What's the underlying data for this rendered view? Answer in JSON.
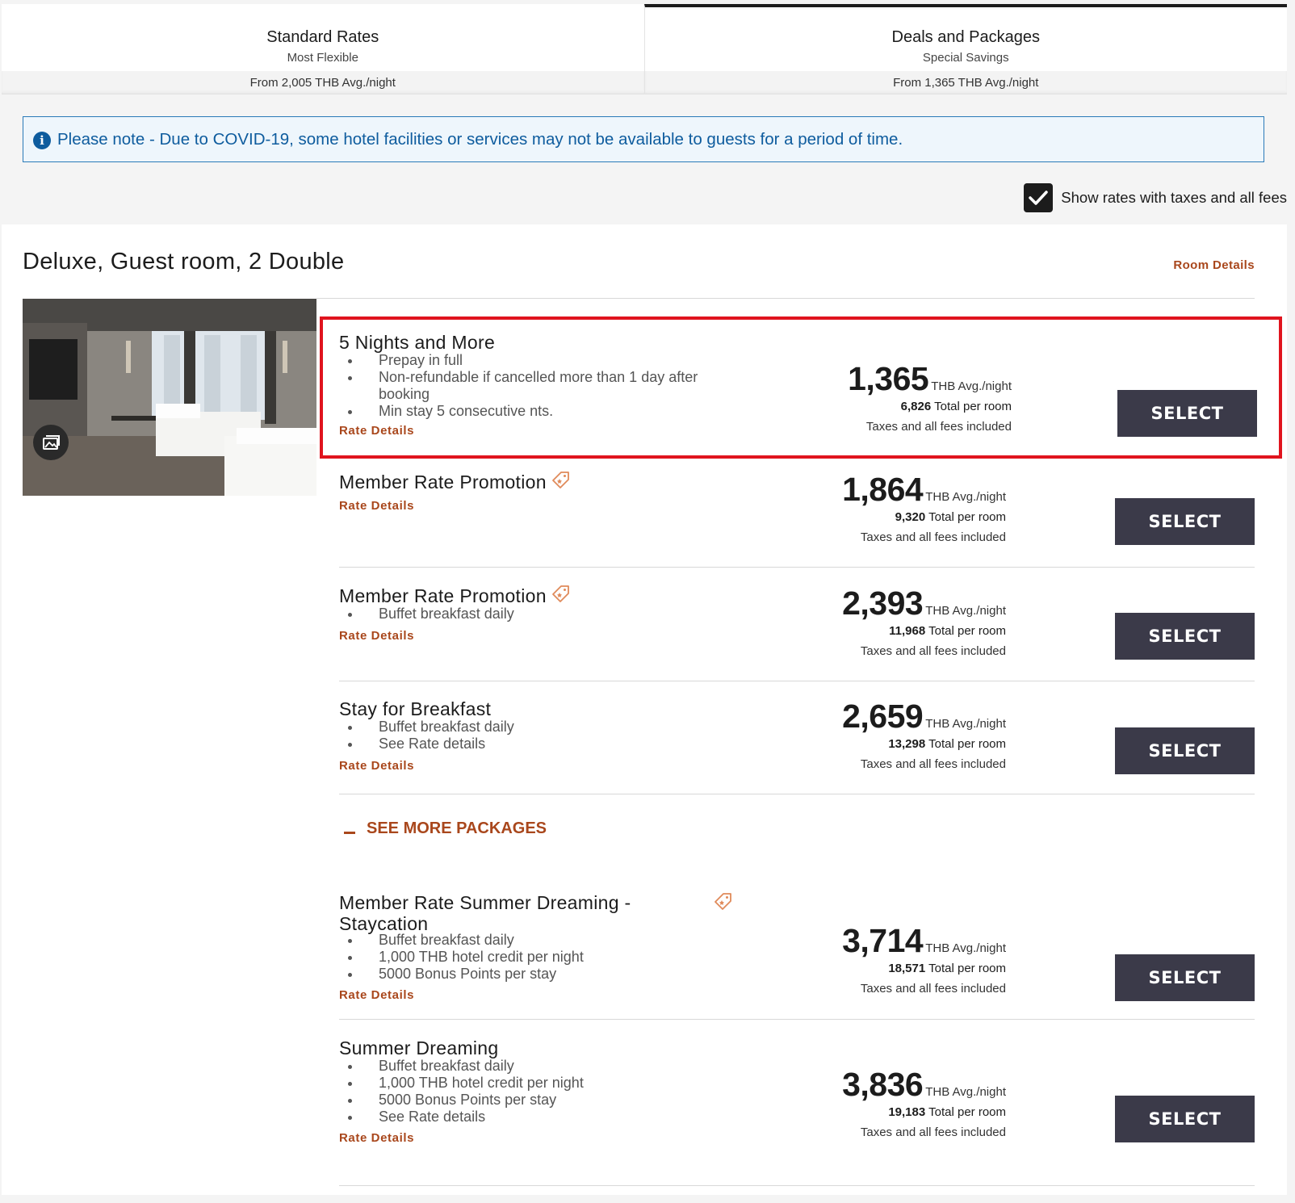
{
  "tabs": [
    {
      "title": "Standard Rates",
      "subtitle": "Most Flexible",
      "from": "From 2,005 THB Avg./night",
      "active": false
    },
    {
      "title": "Deals and Packages",
      "subtitle": "Special Savings",
      "from": "From 1,365 THB Avg./night",
      "active": true
    }
  ],
  "notice": {
    "text": "Please note - Due to COVID-19, some hotel facilities or services may not be available to guests for a period of time."
  },
  "tax_toggle": {
    "label": "Show rates with taxes and all fees",
    "checked": true
  },
  "room": {
    "title": "Deluxe, Guest room, 2 Double",
    "details_link": "Room Details"
  },
  "rate_link_label": "Rate Details",
  "select_label": "SELECT",
  "avg_label": "THB Avg./night",
  "total_suffix": "Total per room",
  "taxes_label": "Taxes and all fees included",
  "rates": [
    {
      "name": "5 Nights and More",
      "bullets": [
        "Prepay in full",
        "Non-refundable if cancelled more than 1 day after booking",
        "Min stay 5 consecutive nts."
      ],
      "price": "1,365",
      "total": "6,826",
      "tag": false,
      "highlighted": true
    },
    {
      "name": "Member Rate Promotion",
      "bullets": [],
      "price": "1,864",
      "total": "9,320",
      "tag": true,
      "highlighted": false
    },
    {
      "name": "Member Rate Promotion",
      "bullets": [
        "Buffet breakfast daily"
      ],
      "price": "2,393",
      "total": "11,968",
      "tag": true,
      "highlighted": false
    },
    {
      "name": "Stay for Breakfast",
      "bullets": [
        "Buffet breakfast daily",
        "See Rate details"
      ],
      "price": "2,659",
      "total": "13,298",
      "tag": false,
      "highlighted": false
    },
    {
      "name": "Member Rate Summer Dreaming - Staycation",
      "bullets": [
        "Buffet breakfast daily",
        "1,000 THB hotel credit per night",
        "5000 Bonus Points per stay"
      ],
      "price": "3,714",
      "total": "18,571",
      "tag": true,
      "highlighted": false
    },
    {
      "name": "Summer Dreaming",
      "bullets": [
        "Buffet breakfast daily",
        "1,000 THB hotel credit per night",
        "5000 Bonus Points per stay",
        "See Rate details"
      ],
      "price": "3,836",
      "total": "19,183",
      "tag": false,
      "highlighted": false
    }
  ],
  "see_more": {
    "label": "SEE MORE PACKAGES"
  },
  "colors": {
    "accent": "#a9471c",
    "highlight": "#e0141e",
    "button": "#3b3a49",
    "notice": "#0e5c9e"
  },
  "icons": {
    "info": "info-icon",
    "check": "check-icon",
    "gallery": "gallery-icon",
    "tag": "tag-icon",
    "minus": "minus-icon"
  }
}
